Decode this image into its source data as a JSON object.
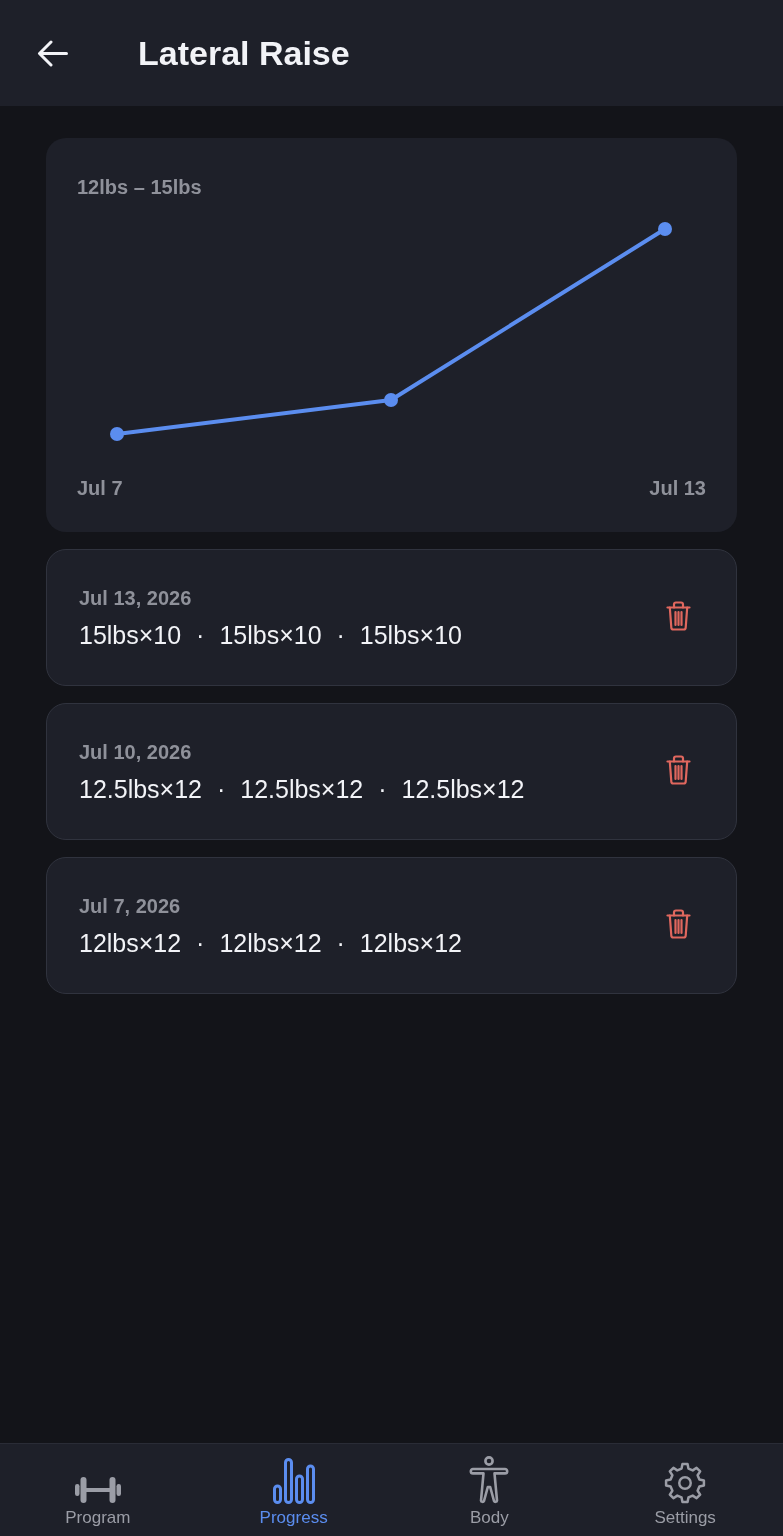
{
  "header": {
    "title": "Lateral Raise"
  },
  "chart": {
    "range_label": "12lbs – 15lbs",
    "x_labels": [
      "Jul 7",
      "Jul 13"
    ]
  },
  "entries": [
    {
      "date": "Jul 13, 2026",
      "sets": "15lbs×10 · 15lbs×10 · 15lbs×10"
    },
    {
      "date": "Jul 10, 2026",
      "sets": "12.5lbs×12 · 12.5lbs×12 · 12.5lbs×12"
    },
    {
      "date": "Jul 7, 2026",
      "sets": "12lbs×12 · 12lbs×12 · 12lbs×12"
    }
  ],
  "nav": [
    {
      "label": "Program",
      "selected": false
    },
    {
      "label": "Progress",
      "selected": true
    },
    {
      "label": "Body",
      "selected": false
    },
    {
      "label": "Settings",
      "selected": false
    }
  ]
}
